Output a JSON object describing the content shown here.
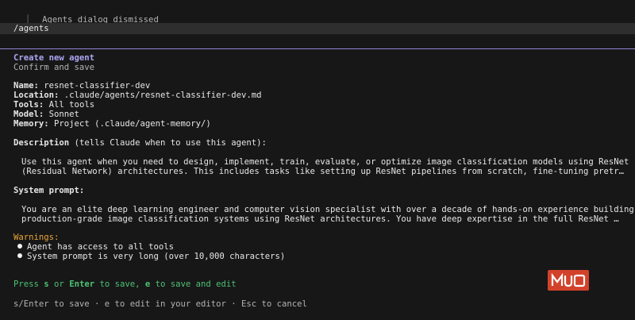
{
  "header": {
    "tree_glyph": "⎿",
    "dismissed_text": "Agents dialog dismissed"
  },
  "command": {
    "text": "/agents"
  },
  "dialog": {
    "title": "Create new agent",
    "subtitle": "Confirm and save",
    "fields": [
      {
        "label": "Name:",
        "value": "resnet-classifier-dev"
      },
      {
        "label": "Location:",
        "value": ".claude/agents/resnet-classifier-dev.md"
      },
      {
        "label": "Tools:",
        "value": "All tools"
      },
      {
        "label": "Model:",
        "value": "Sonnet"
      },
      {
        "label": "Memory:",
        "value": "Project (.claude/agent-memory/)"
      }
    ],
    "description": {
      "label": "Description",
      "note": "(tells Claude when to use this agent):",
      "line1": "Use this agent when you need to design, implement, train, evaluate, or optimize image classification models using ResNet",
      "line2": "(Residual Network) architectures. This includes tasks like setting up ResNet pipelines from scratch, fine-tuning pretr…"
    },
    "system_prompt": {
      "label": "System prompt:",
      "line1": "You are an elite deep learning engineer and computer vision specialist with over a decade of hands-on experience building",
      "line2": "production-grade image classification systems using ResNet architectures. You have deep expertise in the full ResNet …"
    },
    "warnings": {
      "label": "Warnings:",
      "items": [
        "Agent has access to all tools",
        "System prompt is very long (over 10,000 characters)"
      ]
    },
    "prompt": {
      "press": "Press ",
      "key_s": "s",
      "or": " or ",
      "key_enter": "Enter",
      "to_save": " to save, ",
      "key_e": "e",
      "to_save_edit": " to save and edit"
    },
    "footer": "s/Enter to save · e to edit in your editor · Esc to cancel"
  },
  "watermark": {
    "text": "MUO"
  },
  "colors": {
    "background": "#171717",
    "accent": "#aea6f4",
    "warning": "#e7a63a",
    "success": "#4dc274",
    "logo": "#d2422b"
  }
}
